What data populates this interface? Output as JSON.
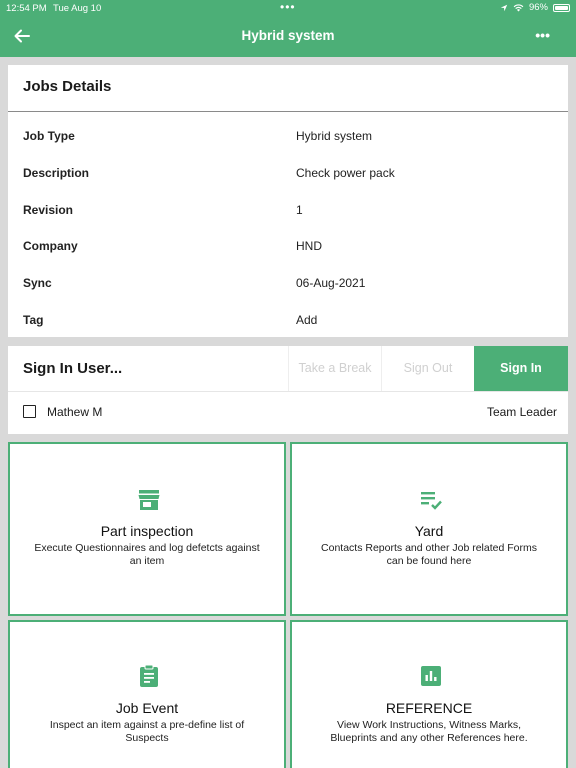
{
  "status_bar": {
    "time": "12:54 PM",
    "date": "Tue Aug 10",
    "battery": "96%"
  },
  "header": {
    "title": "Hybrid system",
    "back_icon": "arrow-left-icon",
    "more_icon": "more-horizontal-icon"
  },
  "details": {
    "title": "Jobs Details",
    "rows": [
      {
        "label": "Job Type",
        "value": "Hybrid system"
      },
      {
        "label": "Description",
        "value": "Check power pack"
      },
      {
        "label": "Revision",
        "value": "1"
      },
      {
        "label": "Company",
        "value": "HND"
      },
      {
        "label": "Sync",
        "value": "06-Aug-2021"
      },
      {
        "label": "Tag",
        "value": "Add"
      }
    ]
  },
  "signin": {
    "title": "Sign In User...",
    "take_break": "Take a Break",
    "sign_out": "Sign Out",
    "sign_in": "Sign In",
    "user": {
      "name": "Mathew M",
      "role": "Team Leader"
    }
  },
  "tiles": [
    {
      "icon": "store-icon",
      "title": "Part inspection",
      "desc": "Execute Questionnaires and log defetcts against an item"
    },
    {
      "icon": "checklist-icon",
      "title": "Yard",
      "desc": "Contacts Reports and other Job related Forms can be found here"
    },
    {
      "icon": "clipboard-icon",
      "title": "Job Event",
      "desc": "Inspect an item against a pre-define  list of Suspects"
    },
    {
      "icon": "bar-chart-icon",
      "title": "REFERENCE",
      "desc": "View Work Instructions, Witness Marks, Blueprints and any other References here."
    }
  ],
  "colors": {
    "accent": "#4caf77"
  }
}
